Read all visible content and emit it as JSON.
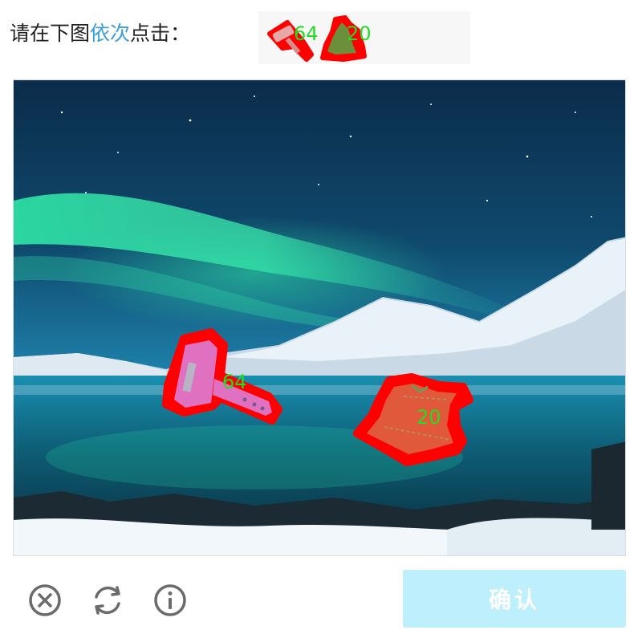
{
  "prompt": {
    "prefix": "请在下图",
    "accent": "依次",
    "suffix": "点击："
  },
  "targets": [
    {
      "icon": "hammer-icon",
      "number": "64"
    },
    {
      "icon": "bell-icon",
      "number": "20"
    }
  ],
  "scene": {
    "description_icon_names": [
      "hammer-icon",
      "bell-icon"
    ],
    "labels": [
      {
        "number": "64"
      },
      {
        "number": "20"
      }
    ]
  },
  "footer": {
    "close_icon": "close-circle-icon",
    "refresh_icon": "refresh-icon",
    "info_icon": "info-icon",
    "confirm_label": "确认"
  },
  "colors": {
    "accent": "#3b9ee0",
    "confirm_bg": "#bdeffc",
    "number_green": "#22dd22",
    "outline_red": "#ff0000"
  }
}
